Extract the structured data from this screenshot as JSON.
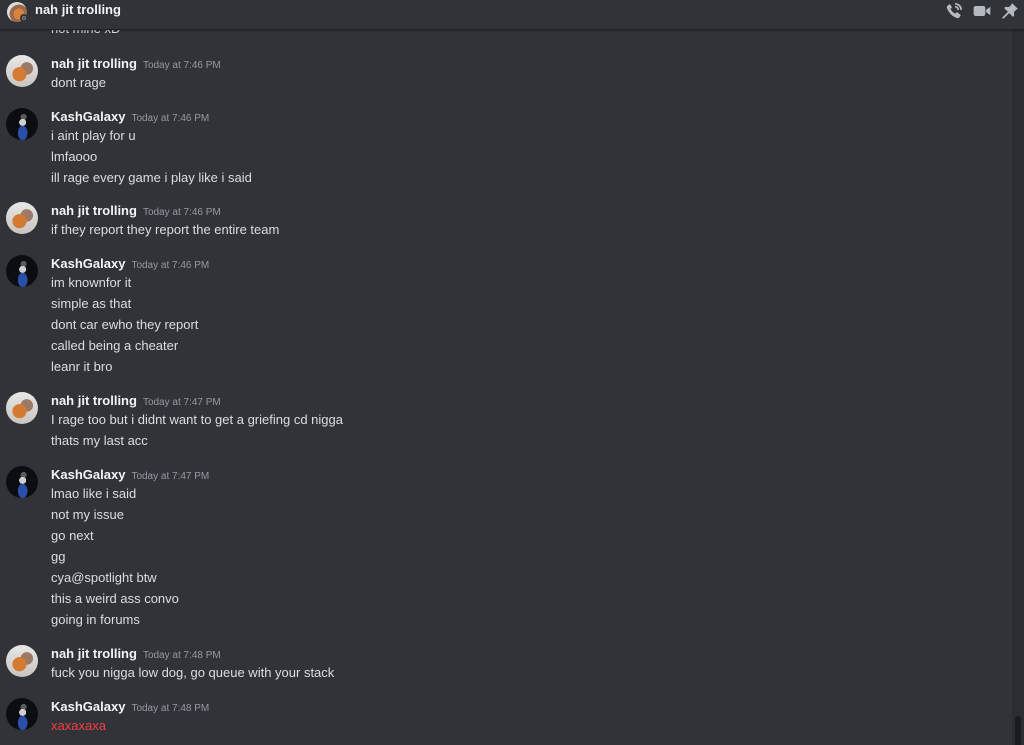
{
  "header": {
    "title": "nah jit trolling",
    "icons": [
      "phone-call-icon",
      "video-camera-icon",
      "pin-icon"
    ]
  },
  "colors": {
    "background": "#313338",
    "username": "#f2f3f5",
    "message_text": "#dbdee1",
    "timestamp": "#949ba4",
    "highlight_text": "#f23f42"
  },
  "partial_line": "not mine xD",
  "messages": [
    {
      "author": "nah jit trolling",
      "timestamp": "Today at 7:46 PM",
      "lines": [
        "dont rage"
      ]
    },
    {
      "author": "KashGalaxy",
      "timestamp": "Today at 7:46 PM",
      "lines": [
        "i aint play for u",
        "lmfaooo",
        "ill rage every game i play like i said"
      ]
    },
    {
      "author": "nah jit trolling",
      "timestamp": "Today at 7:46 PM",
      "lines": [
        "if they report they report the entire team"
      ]
    },
    {
      "author": "KashGalaxy",
      "timestamp": "Today at 7:46 PM",
      "lines": [
        "im knownfor it",
        "simple as that",
        "dont car ewho they report",
        "called being a cheater",
        "leanr it bro"
      ]
    },
    {
      "author": "nah jit trolling",
      "timestamp": "Today at 7:47 PM",
      "lines": [
        "I rage too but i didnt want to get a griefing cd nigga",
        "thats my last acc"
      ]
    },
    {
      "author": "KashGalaxy",
      "timestamp": "Today at 7:47 PM",
      "lines": [
        "lmao like i said",
        "not my issue",
        "go next",
        "gg",
        "cya@spotlight btw",
        "this a weird ass convo",
        "going in forums"
      ]
    },
    {
      "author": "nah jit trolling",
      "timestamp": "Today at 7:48 PM",
      "lines": [
        "fuck you nigga low dog, go queue with your stack"
      ]
    },
    {
      "author": "KashGalaxy",
      "timestamp": "Today at 7:48 PM",
      "lines": [
        "xaxaxaxa"
      ]
    }
  ]
}
